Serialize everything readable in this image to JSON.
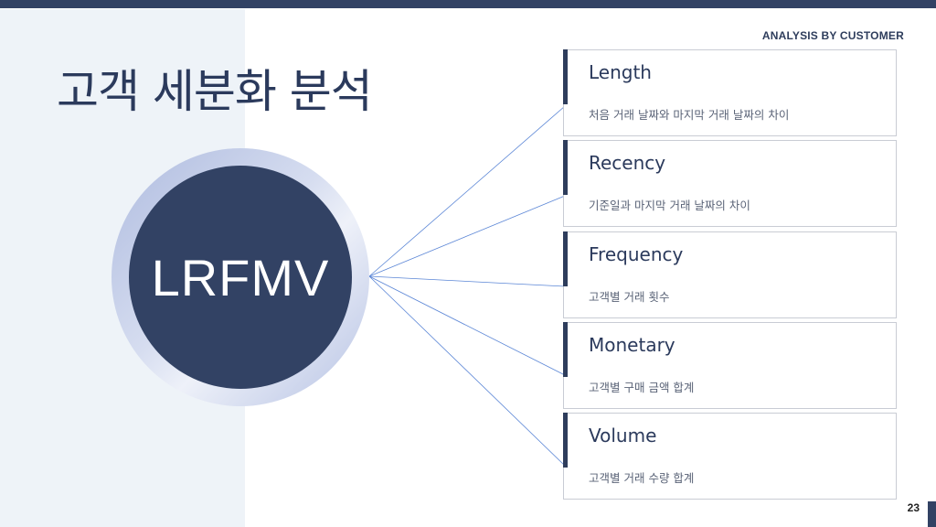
{
  "header": {
    "tag": "ANALYSIS BY CUSTOMER",
    "title": "고객 세분화 분석"
  },
  "center": {
    "label": "LRFMV"
  },
  "cards": [
    {
      "title": "Length",
      "desc": "처음 거래 날짜와 마지막 거래 날짜의 차이"
    },
    {
      "title": "Recency",
      "desc": "기준일과 마지막 거래 날짜의 차이"
    },
    {
      "title": "Frequency",
      "desc": "고객별 거래 횟수"
    },
    {
      "title": "Monetary",
      "desc": "고객별 구매 금액 합계"
    },
    {
      "title": "Volume",
      "desc": "고객별 거래 수량 합계"
    }
  ],
  "footer": {
    "page": "23"
  },
  "colors": {
    "primary": "#324264",
    "sidebar": "#eef3f8",
    "connector": "#5b86d6"
  }
}
